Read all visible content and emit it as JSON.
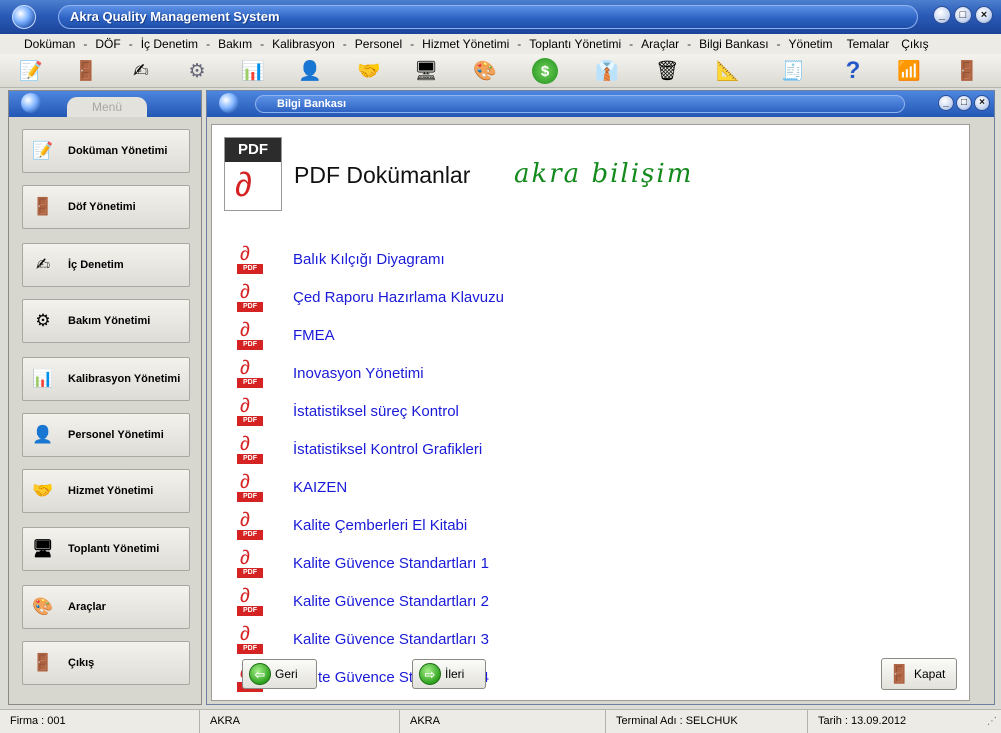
{
  "app": {
    "title": "Akra Quality Management System",
    "window_buttons": [
      "_",
      "□",
      "×"
    ]
  },
  "menu": {
    "items": [
      "Doküman",
      "DÖF",
      "İç Denetim",
      "Bakım",
      "Kalibrasyon",
      "Personel",
      "Hizmet Yönetimi",
      "Toplantı Yönetimi",
      "Araçlar",
      "Bilgi Bankası",
      "Yönetim",
      "Temalar",
      "Çıkış"
    ],
    "separator": "-"
  },
  "toolbar": {
    "icons": [
      "notepad-pen-icon",
      "door-person-icon",
      "pencil-paper-icon",
      "gears-icon",
      "chart-board-icon",
      "person-icon",
      "handshake-icon",
      "meeting-computer-icon",
      "color-blocks-icon",
      "dollar-coin-icon",
      "business-person-icon",
      "person-trash-icon",
      "compass-icon",
      "cash-register-icon",
      "help-question-icon",
      "network-icon",
      "door-exit-icon"
    ],
    "glyphs": [
      "📝",
      "🚪",
      "✍",
      "⚙",
      "📊",
      "👤",
      "🤝",
      "🖥",
      "🎨",
      "$",
      "👔",
      "🗑",
      "📐",
      "🧾",
      "?",
      "📶",
      "🚪"
    ]
  },
  "side_menu": {
    "tab_label": "Menü",
    "items": [
      {
        "label": "Doküman Yönetimi",
        "icon": "📝"
      },
      {
        "label": "Döf Yönetimi",
        "icon": "🚪"
      },
      {
        "label": "İç Denetim",
        "icon": "✍"
      },
      {
        "label": "Bakım Yönetimi",
        "icon": "⚙"
      },
      {
        "label": "Kalibrasyon Yönetimi",
        "icon": "📊"
      },
      {
        "label": "Personel Yönetimi",
        "icon": "👤"
      },
      {
        "label": "Hizmet Yönetimi",
        "icon": "🤝"
      },
      {
        "label": "Toplantı Yönetimi",
        "icon": "🖥"
      },
      {
        "label": "Araçlar",
        "icon": "🎨"
      },
      {
        "label": "Çıkış",
        "icon": "🚪"
      }
    ]
  },
  "content": {
    "window_title": "Bilgi Bankası",
    "header_icon_label": "PDF",
    "page_title": "PDF Dokümanlar",
    "brand_text": "akra bilişim",
    "pdf_tag": "PDF",
    "documents": [
      "Balık Kılçığı Diyagramı",
      "Çed Raporu Hazırlama Klavuzu",
      "FMEA",
      "Inovasyon Yönetimi",
      "İstatistiksel süreç Kontrol",
      "İstatistiksel Kontrol Grafikleri",
      "KAIZEN",
      "Kalite Çemberleri El Kitabi",
      "Kalite Güvence Standartları 1",
      "Kalite Güvence Standartları 2",
      "Kalite Güvence Standartları 3",
      "Kalite Güvence Standartları 4"
    ],
    "buttons": {
      "back": "Geri",
      "next": "İleri",
      "close": "Kapat"
    }
  },
  "status": {
    "firma": "Firma : 001",
    "field2": "AKRA",
    "field3": "AKRA",
    "terminal": "Terminal Adı : SELCHUK",
    "date": "Tarih : 13.09.2012"
  },
  "colors": {
    "title_blue": "#2a5bb7",
    "link_blue": "#1a1ad8",
    "pdf_red": "#d52222",
    "brand_green": "#138a1c"
  }
}
